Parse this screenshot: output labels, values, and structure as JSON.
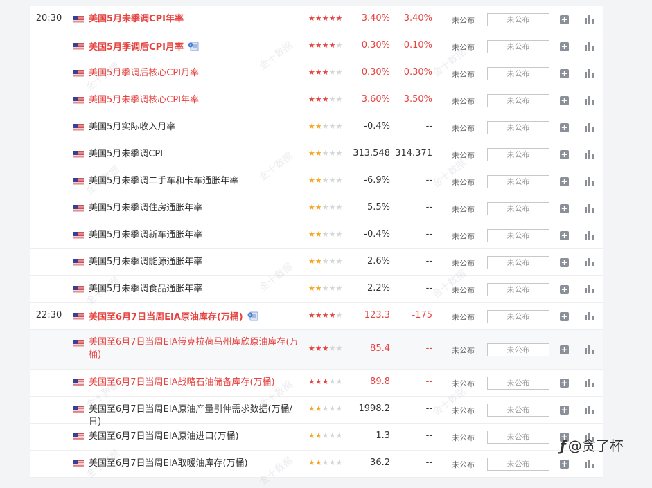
{
  "signature": {
    "logo": "ƒ",
    "text": "@贪了杯"
  },
  "watermark": "金十数据",
  "actual_placeholder": "未公布",
  "colors": {
    "accent_red": "#e64340",
    "star_gold": "#f5a623",
    "star_off": "#d6d6d6"
  },
  "rows": [
    {
      "time": "20:30",
      "flag": "us-flag-icon",
      "name": "美国5月未季调CPI年率",
      "name_color": "red",
      "bold": true,
      "note": false,
      "stars": 5,
      "star_color": "red",
      "prev": "3.40%",
      "forecast": "3.40%",
      "prev_color": "red",
      "forecast_color": "red",
      "status": "未公布",
      "actual": "未公布"
    },
    {
      "time": "",
      "flag": "us-flag-icon",
      "name": "美国5月季调后CPI月率",
      "name_color": "red",
      "bold": true,
      "note": true,
      "stars": 4,
      "star_color": "red",
      "prev": "0.30%",
      "forecast": "0.10%",
      "prev_color": "red",
      "forecast_color": "red",
      "status": "未公布",
      "actual": "未公布"
    },
    {
      "time": "",
      "flag": "us-flag-icon",
      "name": "美国5月季调后核心CPI月率",
      "name_color": "red",
      "bold": false,
      "note": false,
      "stars": 3,
      "star_color": "red",
      "prev": "0.30%",
      "forecast": "0.30%",
      "prev_color": "red",
      "forecast_color": "red",
      "status": "未公布",
      "actual": "未公布"
    },
    {
      "time": "",
      "flag": "us-flag-icon",
      "name": "美国5月未季调核心CPI年率",
      "name_color": "red",
      "bold": false,
      "note": false,
      "stars": 3,
      "star_color": "red",
      "prev": "3.60%",
      "forecast": "3.50%",
      "prev_color": "red",
      "forecast_color": "red",
      "status": "未公布",
      "actual": "未公布"
    },
    {
      "time": "",
      "flag": "us-flag-icon",
      "name": "美国5月实际收入月率",
      "name_color": "dark",
      "bold": false,
      "note": false,
      "stars": 2,
      "star_color": "gold",
      "prev": "-0.4%",
      "forecast": "--",
      "prev_color": "dark",
      "forecast_color": "dark",
      "status": "未公布",
      "actual": "未公布"
    },
    {
      "time": "",
      "flag": "us-flag-icon",
      "name": "美国5月未季调CPI",
      "name_color": "dark",
      "bold": false,
      "note": false,
      "stars": 2,
      "star_color": "gold",
      "prev": "313.548",
      "forecast": "314.371",
      "prev_color": "dark",
      "forecast_color": "dark",
      "status": "未公布",
      "actual": "未公布"
    },
    {
      "time": "",
      "flag": "us-flag-icon",
      "name": "美国5月未季调二手车和卡车通胀年率",
      "name_color": "dark",
      "bold": false,
      "note": false,
      "stars": 2,
      "star_color": "gold",
      "prev": "-6.9%",
      "forecast": "--",
      "prev_color": "dark",
      "forecast_color": "dark",
      "status": "未公布",
      "actual": "未公布"
    },
    {
      "time": "",
      "flag": "us-flag-icon",
      "name": "美国5月未季调住房通胀年率",
      "name_color": "dark",
      "bold": false,
      "note": false,
      "stars": 2,
      "star_color": "gold",
      "prev": "5.5%",
      "forecast": "--",
      "prev_color": "dark",
      "forecast_color": "dark",
      "status": "未公布",
      "actual": "未公布"
    },
    {
      "time": "",
      "flag": "us-flag-icon",
      "name": "美国5月未季调新车通胀年率",
      "name_color": "dark",
      "bold": false,
      "note": false,
      "stars": 2,
      "star_color": "gold",
      "prev": "-0.4%",
      "forecast": "--",
      "prev_color": "dark",
      "forecast_color": "dark",
      "status": "未公布",
      "actual": "未公布"
    },
    {
      "time": "",
      "flag": "us-flag-icon",
      "name": "美国5月未季调能源通胀年率",
      "name_color": "dark",
      "bold": false,
      "note": false,
      "stars": 2,
      "star_color": "gold",
      "prev": "2.6%",
      "forecast": "--",
      "prev_color": "dark",
      "forecast_color": "dark",
      "status": "未公布",
      "actual": "未公布"
    },
    {
      "time": "",
      "flag": "us-flag-icon",
      "name": "美国5月未季调食品通胀年率",
      "name_color": "dark",
      "bold": false,
      "note": false,
      "stars": 2,
      "star_color": "gold",
      "prev": "2.2%",
      "forecast": "--",
      "prev_color": "dark",
      "forecast_color": "dark",
      "status": "未公布",
      "actual": "未公布"
    },
    {
      "time": "22:30",
      "flag": "us-flag-icon",
      "name": "美国至6月7日当周EIA原油库存(万桶)",
      "name_color": "red",
      "bold": true,
      "note": true,
      "stars": 4,
      "star_color": "red",
      "prev": "123.3",
      "forecast": "-175",
      "prev_color": "red",
      "forecast_color": "red",
      "status": "未公布",
      "actual": "未公布"
    },
    {
      "time": "",
      "flag": "us-flag-icon",
      "name": "美国至6月7日当周EIA俄克拉荷马州库欣原油库存(万桶)",
      "name_color": "red",
      "bold": false,
      "note": false,
      "stars": 3,
      "star_color": "red",
      "prev": "85.4",
      "forecast": "--",
      "prev_color": "red",
      "forecast_color": "red",
      "status": "未公布",
      "actual": "未公布",
      "tall": true,
      "highlight": true
    },
    {
      "time": "",
      "flag": "us-flag-icon",
      "name": "美国至6月7日当周EIA战略石油储备库存(万桶)",
      "name_color": "red",
      "bold": false,
      "note": false,
      "stars": 3,
      "star_color": "red",
      "prev": "89.8",
      "forecast": "--",
      "prev_color": "red",
      "forecast_color": "red",
      "status": "未公布",
      "actual": "未公布"
    },
    {
      "time": "",
      "flag": "us-flag-icon",
      "name": "美国至6月7日当周EIA原油产量引伸需求数据(万桶/日)",
      "name_color": "dark",
      "bold": false,
      "note": false,
      "stars": 2,
      "star_color": "gold",
      "prev": "1998.2",
      "forecast": "--",
      "prev_color": "dark",
      "forecast_color": "dark",
      "status": "未公布",
      "actual": "未公布"
    },
    {
      "time": "",
      "flag": "us-flag-icon",
      "name": "美国至6月7日当周EIA原油进口(万桶)",
      "name_color": "dark",
      "bold": false,
      "note": false,
      "stars": 2,
      "star_color": "gold",
      "prev": "1.3",
      "forecast": "--",
      "prev_color": "dark",
      "forecast_color": "dark",
      "status": "未公布",
      "actual": "未公布"
    },
    {
      "time": "",
      "flag": "us-flag-icon",
      "name": "美国至6月7日当周EIA取暖油库存(万桶)",
      "name_color": "dark",
      "bold": false,
      "note": false,
      "stars": 2,
      "star_color": "gold",
      "prev": "36.2",
      "forecast": "--",
      "prev_color": "dark",
      "forecast_color": "dark",
      "status": "未公布",
      "actual": "未公布"
    }
  ]
}
